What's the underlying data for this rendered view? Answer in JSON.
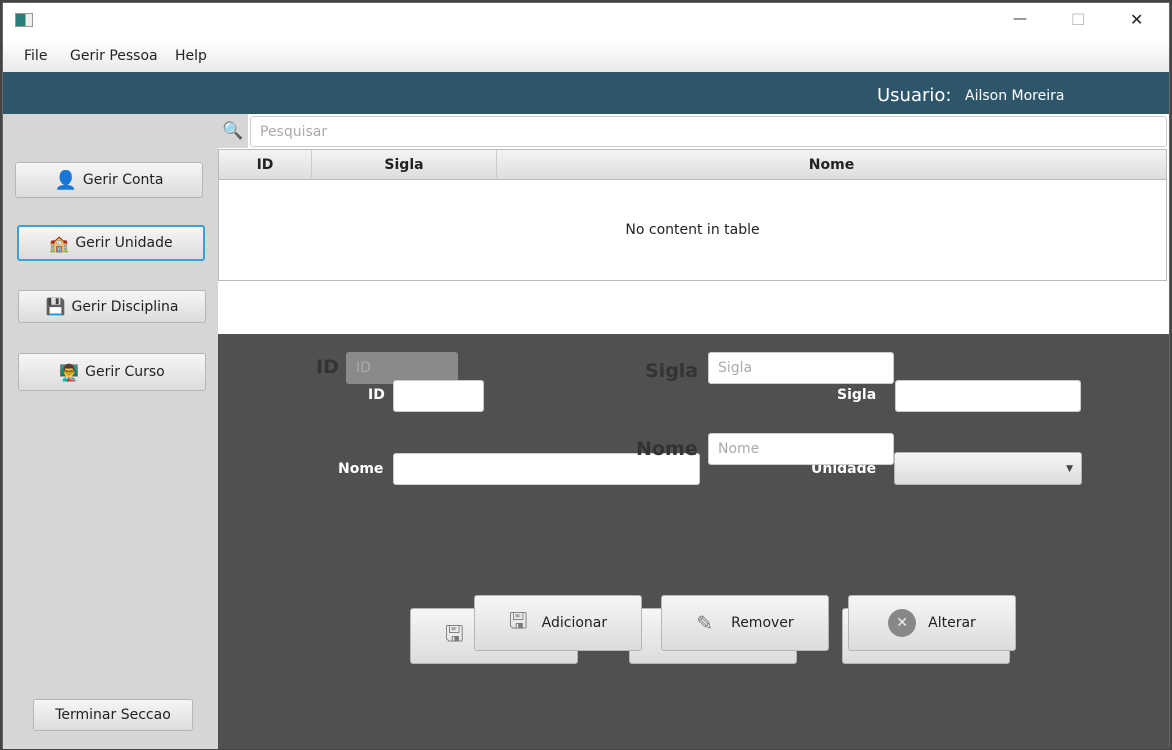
{
  "window": {
    "controls": {
      "minimize": "—",
      "maximize": "☐",
      "close": "✕"
    }
  },
  "menu": [
    "File",
    "Gerir Pessoa",
    "Help"
  ],
  "header": {
    "user_label": "Usuario:",
    "user_name": "Ailson Moreira"
  },
  "sidebar": {
    "items": [
      {
        "label": "Gerir Conta",
        "icon": "user-gear-icon"
      },
      {
        "label": "Gerir Unidade",
        "icon": "school-icon"
      },
      {
        "label": "Gerir Disciplina",
        "icon": "floppy-icon"
      },
      {
        "label": "Gerir Curso",
        "icon": "teacher-board-icon"
      }
    ],
    "logout": "Terminar Seccao"
  },
  "search": {
    "placeholder": "Pesquisar"
  },
  "table": {
    "columns": [
      "ID",
      "Sigla",
      "Nome"
    ],
    "empty": "No content in table"
  },
  "form": {
    "id_label": "ID",
    "id_placeholder": "ID",
    "sigla_label": "Sigla",
    "sigla_placeholder": "Sigla",
    "nome_label": "Nome",
    "nome_placeholder": "Nome",
    "unidade_label": "Unidade",
    "unidade_value": ""
  },
  "actions": {
    "add": "Adicionar",
    "remove": "Remover",
    "edit": "Alterar"
  }
}
